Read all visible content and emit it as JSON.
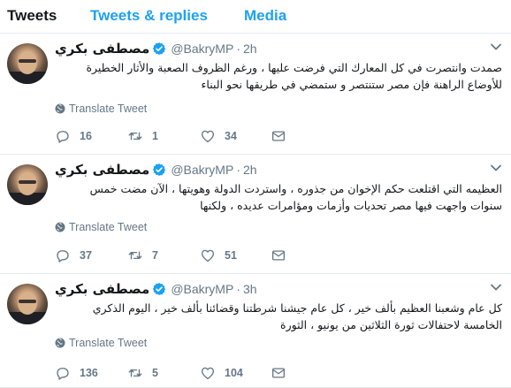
{
  "tabs": {
    "tweets": "Tweets",
    "replies": "Tweets & replies",
    "media": "Media"
  },
  "colors": {
    "accent": "#1da1f2",
    "text": "#14171a",
    "muted": "#657786"
  },
  "tweets": [
    {
      "name": "مصطفى بكري",
      "handle": "@BakryMP",
      "separator": "·",
      "time": "2h",
      "text": "صمدت وانتصرت في كل المعارك التي فرضت عليها ، ورغم الظروف الصعبة والأثار الخطيرة للأوضاع الراهنة فإن مصر ستنتصر و ستمضي في طريقها نحو البناء",
      "translate": "Translate Tweet",
      "replies": "16",
      "retweets": "1",
      "likes": "34"
    },
    {
      "name": "مصطفى بكري",
      "handle": "@BakryMP",
      "separator": "·",
      "time": "2h",
      "text": "العظيمه التي اقتلعت حكم الإخوان من جذوره ، واستردت الدولة وهويتها ، الآن مضت خمس سنوات واجهت فيها مصر تحديات وأزمات ومؤامرات عديده ، ولكنها",
      "translate": "Translate Tweet",
      "replies": "37",
      "retweets": "7",
      "likes": "51"
    },
    {
      "name": "مصطفى بكري",
      "handle": "@BakryMP",
      "separator": "·",
      "time": "3h",
      "text": "كل عام وشعبنا العظيم بألف خير ، كل عام جيشنا شرطتنا وقضائنا بألف خير ، اليوم الذكري الخامسة لاحتفالات ثورة الثلاثين من يونيو ، الثورة",
      "translate": "Translate Tweet",
      "replies": "136",
      "retweets": "5",
      "likes": "104"
    }
  ],
  "icons": {
    "verified": "verified-badge-icon",
    "caret": "chevron-down-icon",
    "globe": "globe-icon",
    "reply": "reply-icon",
    "retweet": "retweet-icon",
    "like": "heart-icon",
    "dm": "envelope-icon"
  }
}
